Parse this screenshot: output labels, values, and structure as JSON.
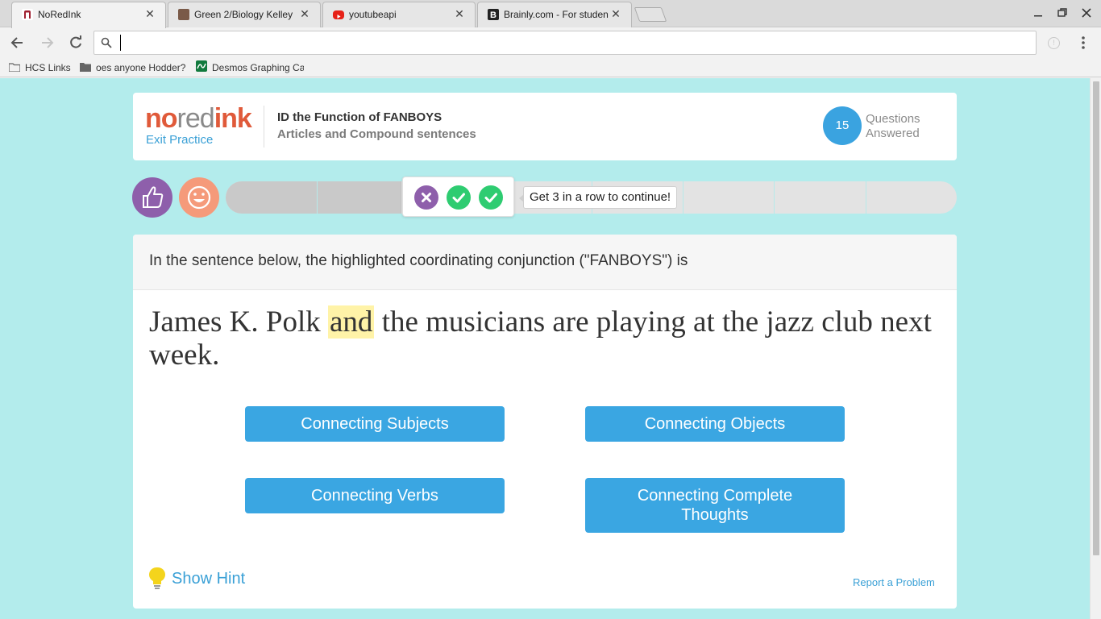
{
  "browser": {
    "tabs": [
      {
        "title": "NoRedInk",
        "active": true,
        "favicon_color": "#a02030"
      },
      {
        "title": "Green 2/Biology Kelley",
        "active": false,
        "favicon_color": "#7a5a48"
      },
      {
        "title": "youtubeapi",
        "active": false,
        "favicon_color": "#e62117"
      },
      {
        "title": "Brainly.com - For studen",
        "active": false,
        "favicon_color": "#222222"
      }
    ],
    "address_value": "",
    "bookmarks": [
      {
        "label": "HCS Links",
        "icon": "folder-icon"
      },
      {
        "label": "oes anyone Hodder?",
        "icon": "folder-icon"
      },
      {
        "label": "Desmos Graphing Ca",
        "icon": "desmos-icon"
      }
    ]
  },
  "header": {
    "logo": {
      "no": "no",
      "red": "red",
      "ink": "ink"
    },
    "exit_label": "Exit Practice",
    "activity_title": "ID the Function of FANBOYS",
    "activity_subtitle": "Articles and Compound sentences",
    "questions_answered": "15",
    "questions_label": "Questions Answered"
  },
  "progress": {
    "fill_fraction": 0.24,
    "segments": 8,
    "streak": [
      "wrong",
      "right",
      "right"
    ],
    "tooltip": "Get 3 in a row to continue!"
  },
  "question": {
    "prompt": "In the sentence below, the highlighted coordinating conjunction (\"FANBOYS\") is",
    "sentence_before": "James K. Polk ",
    "sentence_highlight": "and",
    "sentence_after": " the musicians are playing at the jazz club next week.",
    "answers": [
      "Connecting Subjects",
      "Connecting Objects",
      "Connecting Verbs",
      "Connecting Complete Thoughts"
    ],
    "hint_label": "Show Hint",
    "report_label": "Report a Problem"
  },
  "colors": {
    "page_bg": "#b3ecec",
    "accent_blue": "#3aa6e2",
    "brand_red": "#e05a3a",
    "purple": "#8e5fab",
    "green": "#2ecc71",
    "highlight": "#fff3a8"
  }
}
